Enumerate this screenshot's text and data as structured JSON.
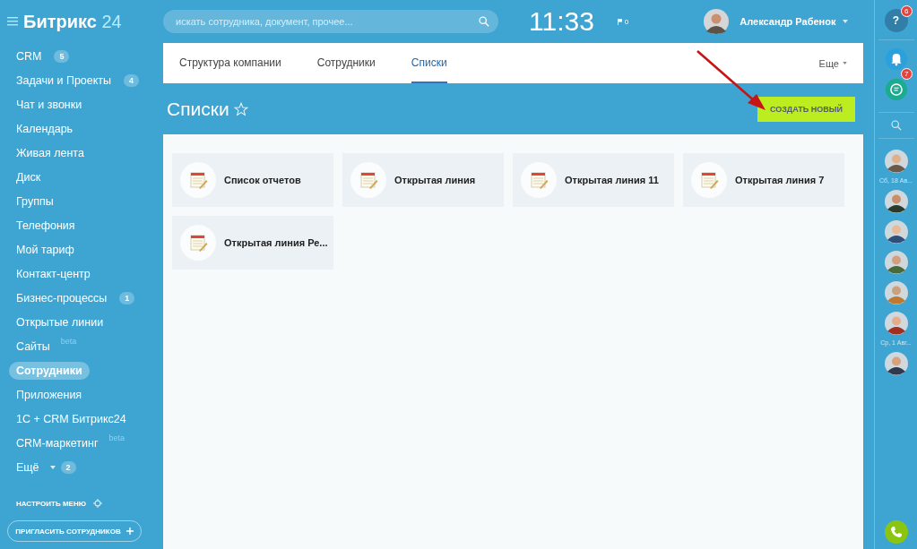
{
  "header": {
    "logo": "Битрикс",
    "logo_suffix": "24",
    "search": {
      "placeholder": "искать сотрудника, документ, прочее..."
    },
    "clock": "11:33",
    "flag_count": "0",
    "user": {
      "name": "Александр Рабенок"
    }
  },
  "sidebar": {
    "items": [
      {
        "label": "CRM",
        "counter": "5",
        "selected": false
      },
      {
        "label": "Задачи и Проекты",
        "counter": "4",
        "selected": false
      },
      {
        "label": "Чат и звонки",
        "selected": false
      },
      {
        "label": "Календарь",
        "selected": false
      },
      {
        "label": "Живая лента",
        "selected": false
      },
      {
        "label": "Диск",
        "selected": false
      },
      {
        "label": "Группы",
        "selected": false
      },
      {
        "label": "Телефония",
        "selected": false
      },
      {
        "label": "Мой тариф",
        "selected": false
      },
      {
        "label": "Контакт-центр",
        "selected": false
      },
      {
        "label": "Бизнес-процессы",
        "counter": "1",
        "selected": false
      },
      {
        "label": "Открытые линии",
        "selected": false
      },
      {
        "label": "Сайты",
        "tag": "beta",
        "selected": false
      },
      {
        "label": "Сотрудники",
        "selected": true
      },
      {
        "label": "Приложения",
        "selected": false
      },
      {
        "label": "1С + CRM Битрикс24",
        "selected": false
      },
      {
        "label": "CRM-маркетинг",
        "tag": "beta",
        "selected": false
      },
      {
        "label": "Ещё",
        "counter": "2",
        "expandable": true,
        "selected": false
      }
    ],
    "settings": "НАСТРОИТЬ МЕНЮ",
    "invite": "ПРИГЛАСИТЬ СОТРУДНИКОВ"
  },
  "tabs": [
    {
      "label": "Структура компании",
      "selected": false
    },
    {
      "label": "Сотрудники",
      "selected": false
    },
    {
      "label": "Списки",
      "selected": true
    }
  ],
  "more": "Еще",
  "page_title": "Списки",
  "create_button": "СОЗДАТЬ НОВЫЙ",
  "lists": [
    {
      "title": "Список отчетов"
    },
    {
      "title": "Открытая линия"
    },
    {
      "title": "Открытая линия 11"
    },
    {
      "title": "Открытая линия 7"
    },
    {
      "title": "Открытая линия Ре..."
    }
  ],
  "right_panel": {
    "help_label": "?",
    "help_badge": "6",
    "notifications_badge": "7",
    "contacts": [
      {
        "kind": "avatar"
      },
      {
        "kind": "date",
        "label": "Сб, 18 Ав..."
      },
      {
        "kind": "avatar"
      },
      {
        "kind": "avatar"
      },
      {
        "kind": "avatar"
      },
      {
        "kind": "avatar"
      },
      {
        "kind": "avatar"
      },
      {
        "kind": "date",
        "label": "Ср, 1 Авг..."
      },
      {
        "kind": "avatar"
      }
    ]
  }
}
